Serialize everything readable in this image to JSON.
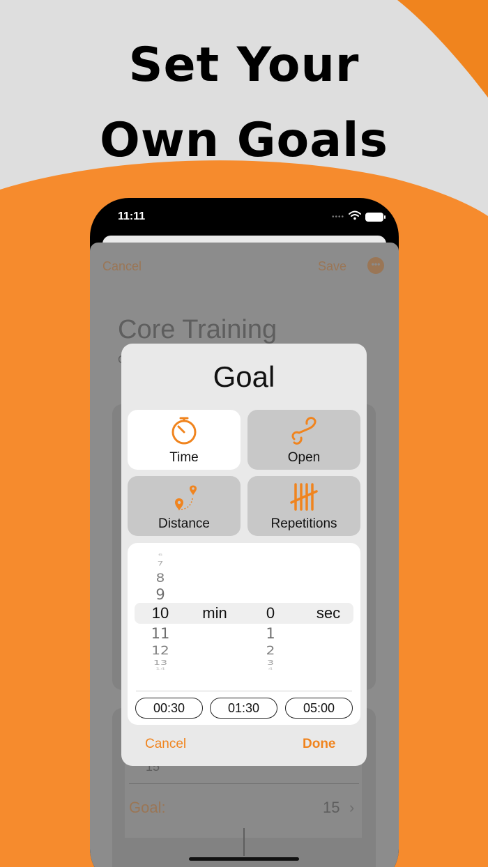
{
  "colors": {
    "accent": "#f0841e",
    "background": "#dedede",
    "dim_accent": "#9a7656"
  },
  "headline": {
    "line1": "Set Your",
    "line2": "Own Goals"
  },
  "status_bar": {
    "time": "11:11"
  },
  "sheet": {
    "cancel": "Cancel",
    "save": "Save",
    "more_icon": "ellipsis-icon",
    "title": "Core Training",
    "subtitle": "C",
    "row_value": "15",
    "goal_label": "Goal:",
    "goal_value": "15"
  },
  "dialog": {
    "title": "Goal",
    "options": [
      {
        "label": "Time",
        "icon": "stopwatch-icon",
        "selected": true
      },
      {
        "label": "Open",
        "icon": "infinity-icon",
        "selected": false
      },
      {
        "label": "Distance",
        "icon": "map-pins-icon",
        "selected": false
      },
      {
        "label": "Repetitions",
        "icon": "tally-icon",
        "selected": false
      }
    ],
    "picker": {
      "minutes_above": [
        "6",
        "7",
        "8",
        "9"
      ],
      "minutes_selected": "10",
      "minutes_below": [
        "11",
        "12",
        "13",
        "14"
      ],
      "minutes_unit": "min",
      "seconds_selected": "0",
      "seconds_below": [
        "1",
        "2",
        "3",
        "4"
      ],
      "seconds_unit": "sec"
    },
    "presets": [
      "00:30",
      "01:30",
      "05:00"
    ],
    "cancel": "Cancel",
    "done": "Done"
  }
}
